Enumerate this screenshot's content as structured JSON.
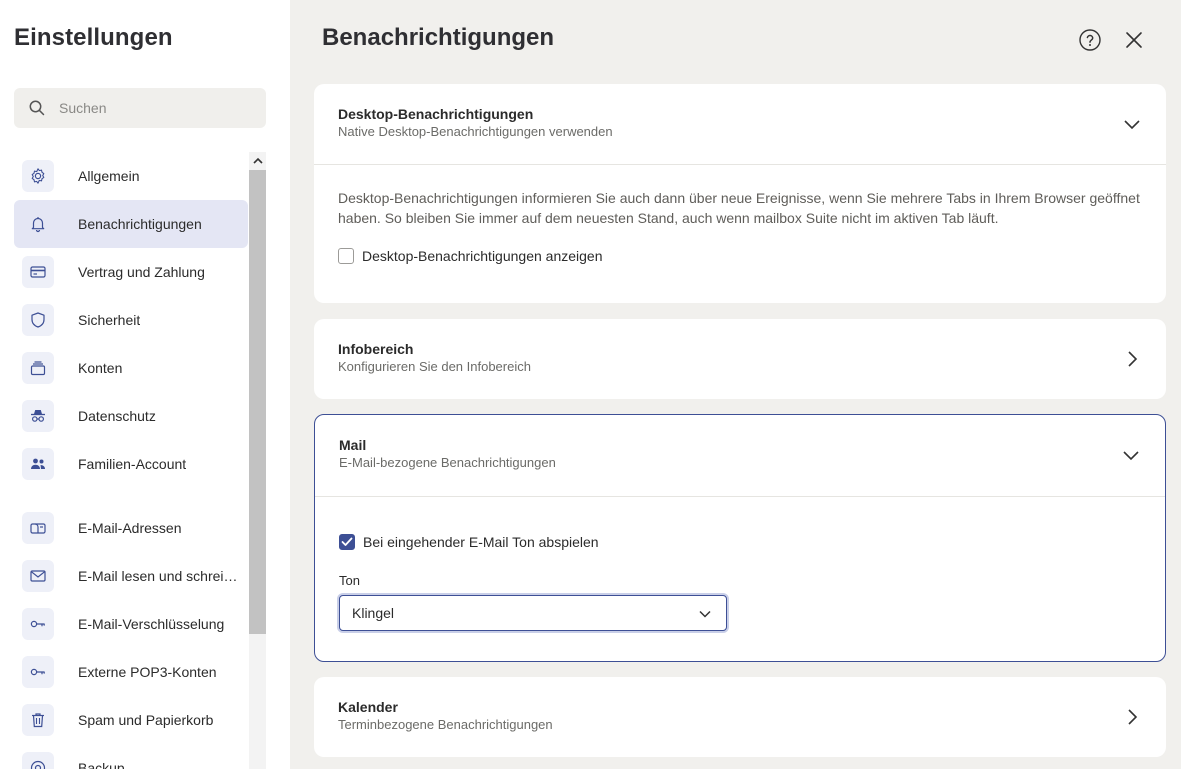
{
  "sidebar": {
    "title": "Einstellungen",
    "search_placeholder": "Suchen",
    "items": [
      {
        "label": "Allgemein",
        "icon": "gear-icon"
      },
      {
        "label": "Benachrichtigungen",
        "icon": "bell-icon",
        "active": true
      },
      {
        "label": "Vertrag und Zahlung",
        "icon": "credit-card-icon"
      },
      {
        "label": "Sicherheit",
        "icon": "shield-icon"
      },
      {
        "label": "Konten",
        "icon": "stacked-accounts-icon"
      },
      {
        "label": "Datenschutz",
        "icon": "incognito-icon"
      },
      {
        "label": "Familien-Account",
        "icon": "family-icon"
      },
      {
        "label": "E-Mail-Adressen",
        "icon": "mailbox-icon"
      },
      {
        "label": "E-Mail lesen und schreiben",
        "icon": "envelope-icon"
      },
      {
        "label": "E-Mail-Verschlüsselung",
        "icon": "key-icon"
      },
      {
        "label": "Externe POP3-Konten",
        "icon": "key-icon"
      },
      {
        "label": "Spam und Papierkorb",
        "icon": "trash-icon"
      },
      {
        "label": "Backup",
        "icon": "backup-icon"
      }
    ]
  },
  "header": {
    "title": "Benachrichtigungen"
  },
  "sections": {
    "desktop": {
      "title": "Desktop-Benachrichtigungen",
      "subtitle": "Native Desktop-Benachrichtigungen verwenden",
      "description": "Desktop-Benachrichtigungen informieren Sie auch dann über neue Ereignisse, wenn Sie mehrere Tabs in Ihrem Browser geöffnet haben. So bleiben Sie immer auf dem neuesten Stand, auch wenn mailbox Suite nicht im aktiven Tab läuft.",
      "checkbox_label": "Desktop-Benachrichtigungen anzeigen",
      "checked": false
    },
    "info": {
      "title": "Infobereich",
      "subtitle": "Konfigurieren Sie den Infobereich"
    },
    "mail": {
      "title": "Mail",
      "subtitle": "E-Mail-bezogene Benachrichtigungen",
      "checkbox_label": "Bei eingehender E-Mail Ton abspielen",
      "checked": true,
      "ton_label": "Ton",
      "ton_value": "Klingel"
    },
    "calendar": {
      "title": "Kalender",
      "subtitle": "Terminbezogene Benachrichtigungen"
    }
  },
  "colors": {
    "accent": "#3d4f95",
    "active_nav": "#e4e6f4",
    "background": "#f1f0ed"
  }
}
